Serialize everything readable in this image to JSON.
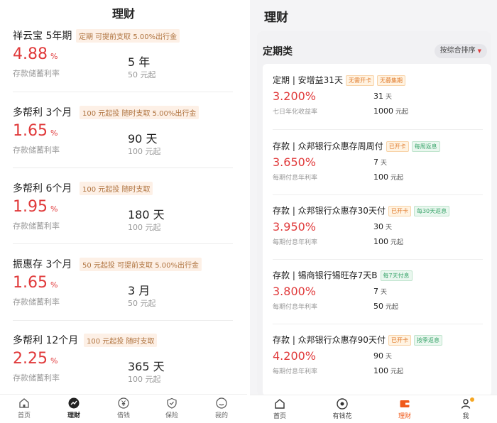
{
  "colors": {
    "rate_red": "#e0393a",
    "accent_orange": "#f05a1a",
    "tag_orange": "#e07a2a",
    "tag_green": "#3aa56b"
  },
  "left": {
    "title": "理财",
    "products": [
      {
        "name": "祥云宝 5年期",
        "tag": "定期  可提前支取 5.00%出行金",
        "rate": "4.88",
        "rate_unit": "%",
        "rate_label": "存款储蓄利率",
        "term": "5 年",
        "min": "50 元起"
      },
      {
        "name": "多帮利 3个月",
        "tag": "100 元起投  随时支取 5.00%出行金",
        "rate": "1.65",
        "rate_unit": "%",
        "rate_label": "存款储蓄利率",
        "term": "90 天",
        "min": "100 元起"
      },
      {
        "name": "多帮利 6个月",
        "tag": "100 元起投  随时支取",
        "rate": "1.95",
        "rate_unit": "%",
        "rate_label": "存款储蓄利率",
        "term": "180 天",
        "min": "100 元起"
      },
      {
        "name": "振惠存 3个月",
        "tag": "50 元起投 可提前支取 5.00%出行金",
        "rate": "1.65",
        "rate_unit": "%",
        "rate_label": "存款储蓄利率",
        "term": "3 月",
        "min": "50 元起"
      },
      {
        "name": "多帮利 12个月",
        "tag": "100 元起投  随时支取",
        "rate": "2.25",
        "rate_unit": "%",
        "rate_label": "存款储蓄利率",
        "term": "365 天",
        "min": "100 元起"
      }
    ],
    "nav": [
      {
        "label": "首页",
        "icon": "home-icon"
      },
      {
        "label": "理财",
        "icon": "wealth-icon",
        "active": true
      },
      {
        "label": "借钱",
        "icon": "yuan-icon"
      },
      {
        "label": "保险",
        "icon": "shield-icon"
      },
      {
        "label": "我的",
        "icon": "profile-icon"
      }
    ]
  },
  "right": {
    "title": "理财",
    "section_title": "定期类",
    "sort_label": "按综合排序",
    "products": [
      {
        "name": "定期 | 安增益31天",
        "tags": [
          {
            "text": "无需开卡",
            "style": "orange"
          },
          {
            "text": "无募集期",
            "style": "orange"
          }
        ],
        "rate": "3.200%",
        "rate_label": "七日年化收益率",
        "term_value": "31",
        "term_unit": "天",
        "min_value": "1000",
        "min_unit": "元起"
      },
      {
        "name": "存款 | 众邦银行众惠存周周付",
        "tags": [
          {
            "text": "已开卡",
            "style": "orange"
          },
          {
            "text": "每周返息",
            "style": "green"
          }
        ],
        "rate": "3.650%",
        "rate_label": "每期付息年利率",
        "term_value": "7",
        "term_unit": "天",
        "min_value": "100",
        "min_unit": "元起"
      },
      {
        "name": "存款 | 众邦银行众惠存30天付",
        "tags": [
          {
            "text": "已开卡",
            "style": "orange"
          },
          {
            "text": "每30天返息",
            "style": "green"
          }
        ],
        "rate": "3.950%",
        "rate_label": "每期付息年利率",
        "term_value": "30",
        "term_unit": "天",
        "min_value": "100",
        "min_unit": "元起"
      },
      {
        "name": "存款 | 锡商银行锡旺存7天B",
        "tags": [
          {
            "text": "每7天付息",
            "style": "green"
          }
        ],
        "rate": "3.800%",
        "rate_label": "每期付息年利率",
        "term_value": "7",
        "term_unit": "天",
        "min_value": "50",
        "min_unit": "元起"
      },
      {
        "name": "存款 | 众邦银行众惠存90天付",
        "tags": [
          {
            "text": "已开卡",
            "style": "orange"
          },
          {
            "text": "按季返息",
            "style": "green"
          }
        ],
        "rate": "4.200%",
        "rate_label": "每期付息年利率",
        "term_value": "90",
        "term_unit": "天",
        "min_value": "100",
        "min_unit": "元起"
      }
    ],
    "nav": [
      {
        "label": "首页",
        "icon": "home-icon"
      },
      {
        "label": "有钱花",
        "icon": "target-icon"
      },
      {
        "label": "理财",
        "icon": "wallet-icon",
        "active": true
      },
      {
        "label": "我",
        "icon": "profile-icon"
      }
    ]
  }
}
